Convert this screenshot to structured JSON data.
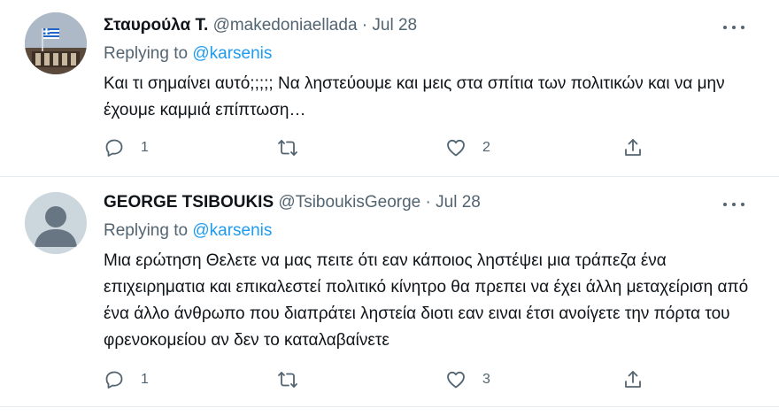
{
  "tweets": [
    {
      "display_name": "Σταυρούλα Τ.",
      "handle": "@makedoniaellada",
      "separator": "·",
      "date": "Jul 28",
      "replying_prefix": "Replying to",
      "replying_to": "@karsenis",
      "text": "Και τι σημαίνει αυτό;;;;; Να ληστεύουμε και μεις στα σπίτια των πολιτικών και να μην έχουμε καμμιά επίπτωση…",
      "reply_count": "1",
      "retweet_count": "",
      "like_count": "2"
    },
    {
      "display_name": "GEORGE TSIBOUKIS",
      "handle": "@TsiboukisGeorge",
      "separator": "·",
      "date": "Jul 28",
      "replying_prefix": "Replying to",
      "replying_to": "@karsenis",
      "text": "Μια ερώτηση Θελετε να μας πειτε ότι εαν κάποιος ληστέψει μια τράπεζα ένα επιχειρηματια και επικαλεστεί πολιτικό κίνητρο θα πρεπει να έχει άλλη μεταχείριση από ένα άλλο άνθρωπο που διαπράτει ληστεία διοτι εαν ειναι έτσι ανοίγετε την πόρτα του φρενοκομείου αν δεν το καταλαβαίνετε",
      "reply_count": "1",
      "retweet_count": "",
      "like_count": "3"
    }
  ],
  "icons": {
    "reply": "reply-icon",
    "retweet": "retweet-icon",
    "like": "heart-icon",
    "share": "share-icon",
    "more": "more-icon"
  },
  "colors": {
    "link": "#1d9bf0",
    "secondary": "#536471",
    "primary": "#0f1419",
    "divider": "#e6ecf0"
  }
}
